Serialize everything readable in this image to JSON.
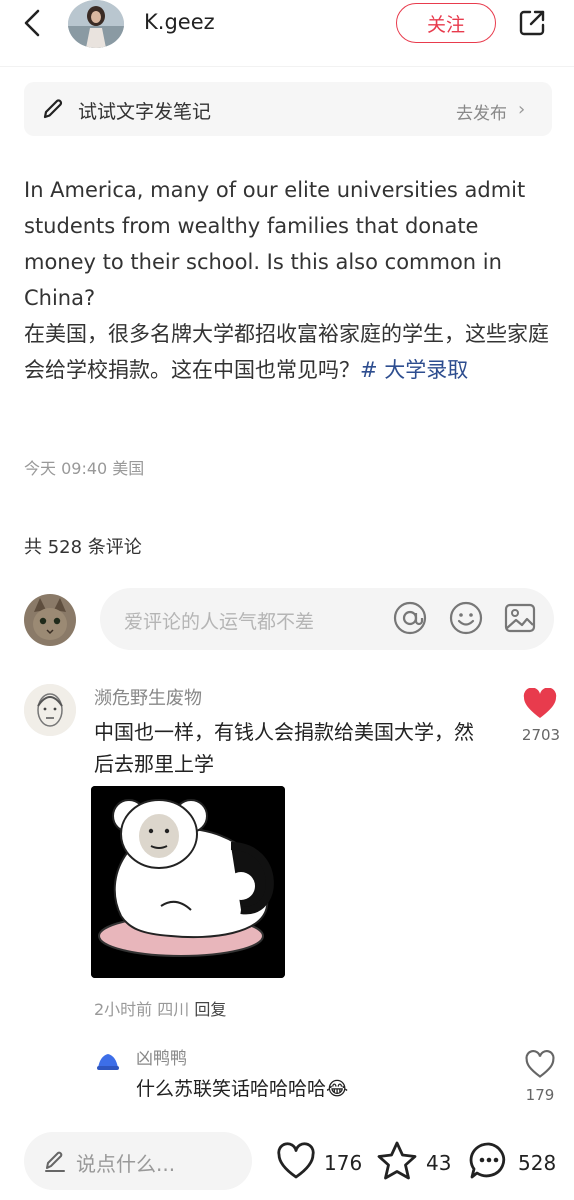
{
  "header": {
    "username": "K.geez",
    "follow_label": "关注"
  },
  "try_bar": {
    "label": "试试文字发笔记",
    "action": "去发布"
  },
  "post": {
    "text_en": "In America, many of our elite universities admit students from wealthy families that donate money to their school. Is this also common in China?",
    "text_zh": "在美国，很多名牌大学都招收富裕家庭的学生，这些家庭会给学校捐款。这在中国也常见吗？",
    "tag": "# 大学录取",
    "time": "今天 09:40",
    "location": "美国"
  },
  "comments_header": {
    "count_label": "共 528 条评论"
  },
  "comment_input": {
    "placeholder": "爱评论的人运气都不差"
  },
  "comments": [
    {
      "name": "濒危野生废物",
      "text": "中国也一样，有钱人会捐款给美国大学，然后去那里上学",
      "likes": "2703",
      "time": "2小时前",
      "location": "四川",
      "reply_label": "回复",
      "liked_color": "#e83b4d",
      "replies": [
        {
          "name": "凶鸭鸭",
          "text": "什么苏联笑话哈哈哈哈😂",
          "likes": "179"
        }
      ]
    }
  ],
  "bottom_bar": {
    "input_placeholder": "说点什么...",
    "likes": "176",
    "stars": "43",
    "comments": "528"
  },
  "colors": {
    "accent": "#e83b4d",
    "tag": "#2d4d8f"
  },
  "icons": [
    "back-arrow-icon",
    "share-icon",
    "pencil-icon",
    "chevron-right-icon",
    "at-icon",
    "emoji-icon",
    "image-icon",
    "heart-icon",
    "star-icon",
    "comment-icon"
  ]
}
